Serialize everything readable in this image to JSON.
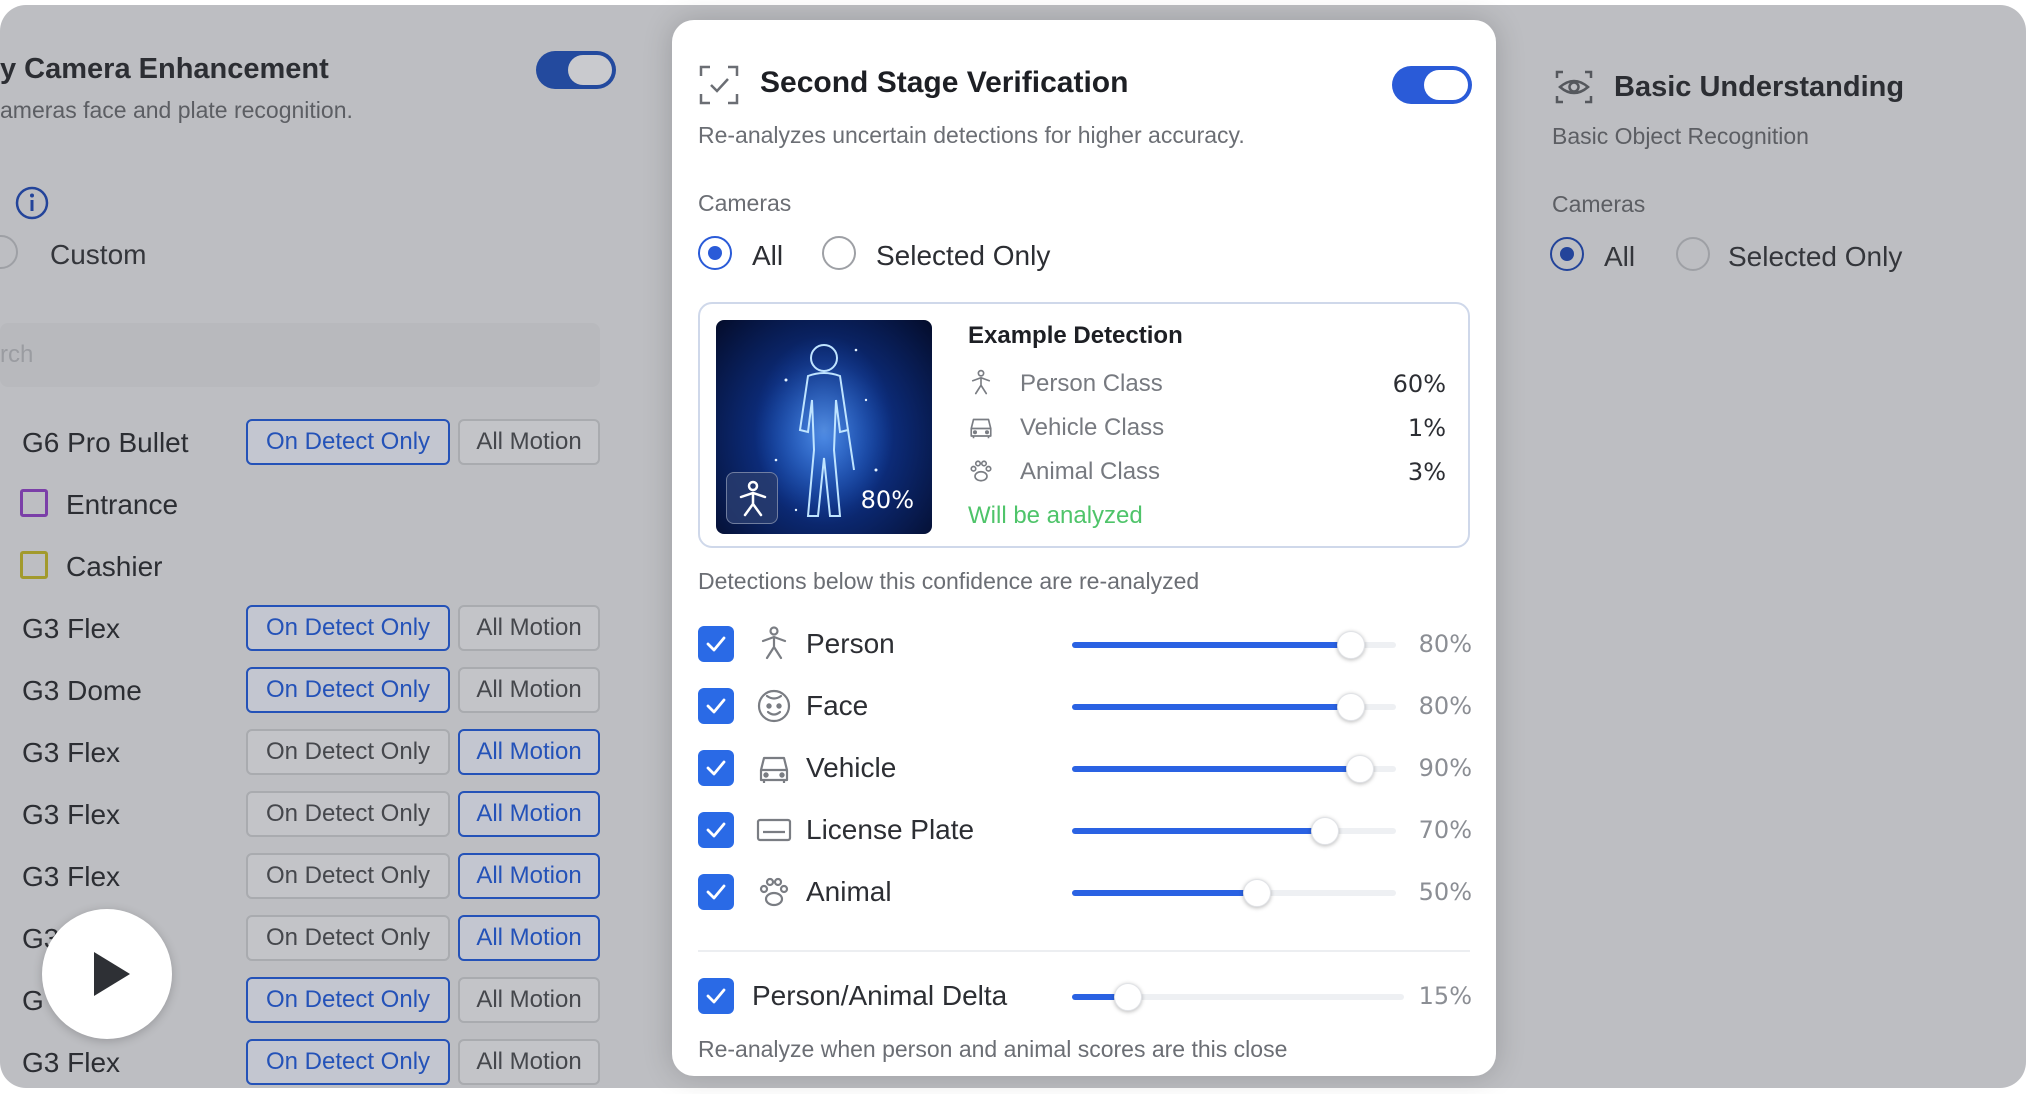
{
  "left_panel": {
    "title": "y Camera Enhancement",
    "subtitle": "ameras face and plate recognition.",
    "custom_label": "Custom",
    "search_placeholder": "rch",
    "on_detect_label": "On Detect Only",
    "all_motion_label": "All Motion",
    "rows": [
      {
        "name": "G6 Pro Bullet",
        "mode": "on_detect"
      },
      {
        "name": "Entrance",
        "zone": true,
        "zone_color": "#7b3fa8"
      },
      {
        "name": "Cashier",
        "zone": true,
        "zone_color": "#a29a2c"
      },
      {
        "name": "G3 Flex",
        "mode": "on_detect"
      },
      {
        "name": "G3 Dome",
        "mode": "on_detect"
      },
      {
        "name": "G3 Flex",
        "mode": "all_motion"
      },
      {
        "name": "G3 Flex",
        "mode": "all_motion"
      },
      {
        "name": "G3 Flex",
        "mode": "all_motion"
      },
      {
        "name": "G3",
        "mode": "all_motion"
      },
      {
        "name": "G",
        "mode": "on_detect"
      },
      {
        "name": "G3 Flex",
        "mode": "on_detect"
      }
    ]
  },
  "modal": {
    "title": "Second Stage Verification",
    "description": "Re-analyzes uncertain detections for higher accuracy.",
    "enabled": true,
    "cameras_label": "Cameras",
    "camera_options": [
      {
        "label": "All",
        "selected": true
      },
      {
        "label": "Selected Only",
        "selected": false
      }
    ],
    "example": {
      "title": "Example Detection",
      "thumb_confidence": "80%",
      "classes": [
        {
          "label": "Person Class",
          "value": "60%",
          "icon": "person-icon"
        },
        {
          "label": "Vehicle Class",
          "value": "1%",
          "icon": "vehicle-icon"
        },
        {
          "label": "Animal Class",
          "value": "3%",
          "icon": "paw-icon"
        }
      ],
      "status": "Will be analyzed",
      "status_color": "#4fc46a"
    },
    "threshold_label": "Detections below this confidence are re-analyzed",
    "detections": [
      {
        "name": "Person",
        "value": "80%",
        "level": 0.86,
        "checked": true,
        "icon": "person-icon"
      },
      {
        "name": "Face",
        "value": "80%",
        "level": 0.86,
        "checked": true,
        "icon": "face-icon"
      },
      {
        "name": "Vehicle",
        "value": "90%",
        "level": 0.89,
        "checked": true,
        "icon": "vehicle-icon"
      },
      {
        "name": "License Plate",
        "value": "70%",
        "level": 0.78,
        "checked": true,
        "icon": "license-plate-icon"
      },
      {
        "name": "Animal",
        "value": "50%",
        "level": 0.57,
        "checked": true,
        "icon": "paw-icon"
      }
    ],
    "delta": {
      "name": "Person/Animal Delta",
      "value": "15%",
      "level": 0.17,
      "checked": true
    },
    "delta_note": "Re-analyze when person and animal scores are this close"
  },
  "right_panel": {
    "title": "Basic Understanding",
    "subtitle": "Basic Object Recognition",
    "cameras_label": "Cameras",
    "options": [
      {
        "label": "All",
        "selected": true
      },
      {
        "label": "Selected Only",
        "selected": false
      }
    ]
  },
  "colors": {
    "accent": "#2a62e3",
    "success": "#4fc46a"
  }
}
